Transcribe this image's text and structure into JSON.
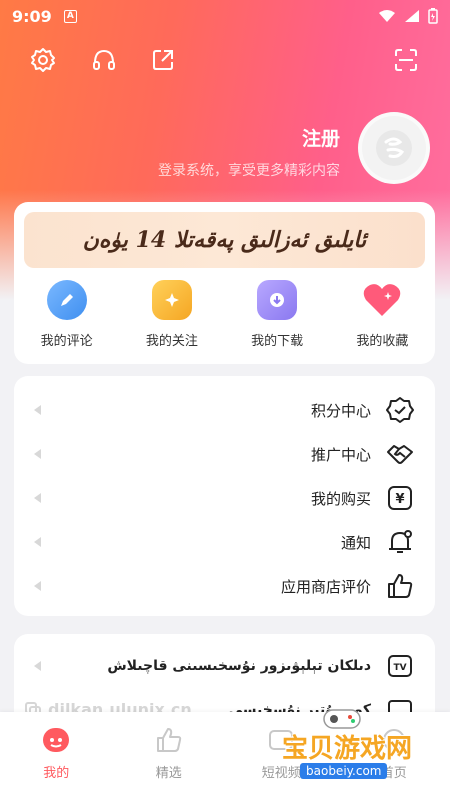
{
  "status": {
    "time": "9:09",
    "badge": "A"
  },
  "profile": {
    "register_label": "注册",
    "subtitle": "登录系统，享受更多精彩内容"
  },
  "banner": {
    "text": "ئايلىق ئەزالىق پەقەتلا 14 يۈەن"
  },
  "shortcuts": [
    {
      "label": "我的评论",
      "icon": "comment-icon",
      "color": "#4a9cf0"
    },
    {
      "label": "我的关注",
      "icon": "star-follow-icon",
      "color": "#f7b733"
    },
    {
      "label": "我的下载",
      "icon": "download-icon",
      "color": "#9b8cf7"
    },
    {
      "label": "我的收藏",
      "icon": "heart-icon",
      "color": "#ff5a7a"
    }
  ],
  "menu": [
    {
      "label": "积分中心",
      "icon": "points-badge-icon"
    },
    {
      "label": "推广中心",
      "icon": "handshake-icon"
    },
    {
      "label": "我的购买",
      "icon": "yen-icon"
    },
    {
      "label": "通知",
      "icon": "bell-icon"
    },
    {
      "label": "应用商店评价",
      "icon": "thumbs-up-icon"
    }
  ],
  "menu2": [
    {
      "label": "دىلكان تېلېۋىزور نۇسخىسىنى قاچىلاش",
      "icon": "tv-icon"
    },
    {
      "label": "كومپيۇتېر نۇسخىسى",
      "icon": "computer-icon"
    }
  ],
  "watermark": {
    "url": "dilkan.ulunix.cn"
  },
  "tabs": [
    {
      "label": "我的",
      "active": true
    },
    {
      "label": "精选",
      "active": false
    },
    {
      "label": "短视频",
      "active": false
    },
    {
      "label": "首页",
      "active": false
    }
  ],
  "site_logo": {
    "brand": "宝贝游戏网",
    "url": "baobeiy.com"
  },
  "colors": {
    "accent": "#ff5a5f",
    "hero_start": "#ff7a45",
    "hero_end": "#ff6fa0"
  }
}
